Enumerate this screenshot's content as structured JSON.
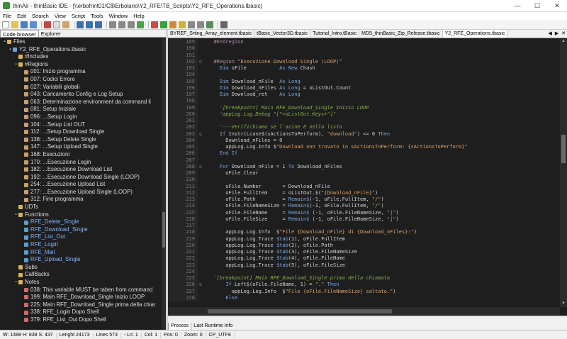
{
  "window": {
    "title": "thinAir - thinBasic IDE - [\\\\erbofrint01\\C$\\Erbolario\\Y2_RFE\\TB_Scripts\\Y2_RFE_Operations.tbasic]",
    "minimize": "—",
    "maximize": "☐",
    "close": "✕"
  },
  "menu": [
    "File",
    "Edit",
    "Search",
    "View",
    "Script",
    "Tools",
    "Window",
    "Help"
  ],
  "left_panel": {
    "tabs": [
      "Code browser",
      "Explorer"
    ],
    "tree": [
      {
        "indent": 0,
        "exp": "▪",
        "icon": "folder",
        "label": "Files"
      },
      {
        "indent": 1,
        "exp": "▪",
        "icon": "file",
        "label": "Y2_RFE_Operations.tbasic"
      },
      {
        "indent": 2,
        "exp": "",
        "icon": "folder",
        "label": "#Includes"
      },
      {
        "indent": 2,
        "exp": "▪",
        "icon": "folder",
        "label": "#Regions"
      },
      {
        "indent": 3,
        "exp": "",
        "icon": "region",
        "label": "001: Inizio programma"
      },
      {
        "indent": 3,
        "exp": "",
        "icon": "region",
        "label": "007: Codici Errore"
      },
      {
        "indent": 3,
        "exp": "",
        "icon": "region",
        "label": "027: Variabili globali"
      },
      {
        "indent": 3,
        "exp": "",
        "icon": "region",
        "label": "043: Caricamento Config e Log Setup"
      },
      {
        "indent": 3,
        "exp": "",
        "icon": "region",
        "label": "063: Determinazione environment da command li"
      },
      {
        "indent": 3,
        "exp": "",
        "icon": "region",
        "label": "081: Setup Iniziale"
      },
      {
        "indent": 3,
        "exp": "",
        "icon": "region",
        "label": "096: ...Setup Login"
      },
      {
        "indent": 3,
        "exp": "",
        "icon": "region",
        "label": "104: ...Setup List OUT"
      },
      {
        "indent": 3,
        "exp": "",
        "icon": "region",
        "label": "112: ...Setup Download Single"
      },
      {
        "indent": 3,
        "exp": "",
        "icon": "region",
        "label": "138: ...Setup Delete Single"
      },
      {
        "indent": 3,
        "exp": "",
        "icon": "region",
        "label": "147: ...Setup Upload Single"
      },
      {
        "indent": 3,
        "exp": "",
        "icon": "region",
        "label": "168: Esecuzioni"
      },
      {
        "indent": 3,
        "exp": "",
        "icon": "region",
        "label": "170: ...Esecuzione Login"
      },
      {
        "indent": 3,
        "exp": "",
        "icon": "region",
        "label": "182: ...Esecuzione Download List"
      },
      {
        "indent": 3,
        "exp": "",
        "icon": "region",
        "label": "192: ...Esecuzione Download Single (LOOP)"
      },
      {
        "indent": 3,
        "exp": "",
        "icon": "region",
        "label": "254: ...Esecuzione Upload List"
      },
      {
        "indent": 3,
        "exp": "",
        "icon": "region",
        "label": "277: ...Esecuzione Upload Single (LOOP)"
      },
      {
        "indent": 3,
        "exp": "",
        "icon": "region",
        "label": "312: Fine programma"
      },
      {
        "indent": 2,
        "exp": "",
        "icon": "folder",
        "label": "UDTs"
      },
      {
        "indent": 2,
        "exp": "▪",
        "icon": "folder",
        "label": "Functions"
      },
      {
        "indent": 3,
        "exp": "",
        "icon": "func",
        "label": "RFE_Delete_Single",
        "fn": true
      },
      {
        "indent": 3,
        "exp": "",
        "icon": "func",
        "label": "RFE_Download_Single",
        "fn": true
      },
      {
        "indent": 3,
        "exp": "",
        "icon": "func",
        "label": "RFE_List_Out",
        "fn": true
      },
      {
        "indent": 3,
        "exp": "",
        "icon": "func",
        "label": "RFE_Login",
        "fn": true
      },
      {
        "indent": 3,
        "exp": "",
        "icon": "func",
        "label": "RFE_Mail",
        "fn": true
      },
      {
        "indent": 3,
        "exp": "",
        "icon": "func",
        "label": "RFE_Upload_Single",
        "fn": true
      },
      {
        "indent": 2,
        "exp": "",
        "icon": "folder",
        "label": "Subs"
      },
      {
        "indent": 2,
        "exp": "",
        "icon": "folder",
        "label": "CallBacks"
      },
      {
        "indent": 2,
        "exp": "▪",
        "icon": "folder",
        "label": "Notes"
      },
      {
        "indent": 3,
        "exp": "",
        "icon": "note",
        "label": "038: This variable MUST be taben from command"
      },
      {
        "indent": 3,
        "exp": "",
        "icon": "note",
        "label": "199: Main RFE_Download_Single Inizio LOOP"
      },
      {
        "indent": 3,
        "exp": "",
        "icon": "note",
        "label": "225: Main RFE_Download_Single prima della chiar"
      },
      {
        "indent": 3,
        "exp": "",
        "icon": "note",
        "label": "338: RFE_Login Dopo Shell"
      },
      {
        "indent": 3,
        "exp": "",
        "icon": "note",
        "label": "379: RFE_List_Out Dopo Shell"
      }
    ]
  },
  "editor": {
    "tabs": [
      "BYREF_Srting_Array_element.tbasic",
      "tBasic_Vector3D.tbasic",
      "Tutorial_Intro.tBasic",
      "MD5_thinBasic_Zip_Release.tbasic",
      "Y2_RFE_Operations.tbasic"
    ],
    "active_tab": 4,
    "lines": [
      {
        "n": "189",
        "f": "",
        "h": "  <span class='meta'>#Endregion</span>"
      },
      {
        "n": "190",
        "f": "",
        "h": ""
      },
      {
        "n": "191",
        "f": "",
        "h": ""
      },
      {
        "n": "192",
        "f": "⊟",
        "h": "  <span class='meta'>#Region</span> <span class='str'>\"Esecuzione Download Single (LOOP)\"</span>"
      },
      {
        "n": "193",
        "f": "",
        "h": "    <span class='kw'>Dim</span> oFile           <span class='kw'>As New</span> Chash"
      },
      {
        "n": "194",
        "f": "",
        "h": ""
      },
      {
        "n": "195",
        "f": "",
        "h": "    <span class='kw'>Dim</span> Download_nFile  <span class='kw'>As Long</span>"
      },
      {
        "n": "196",
        "f": "",
        "h": "    <span class='kw'>Dim</span> Download_nFiles <span class='kw'>As Long</span> = oListOut.Count"
      },
      {
        "n": "197",
        "f": "",
        "h": "    <span class='kw'>Dim</span> Download_ret    <span class='kw'>As Long</span>"
      },
      {
        "n": "198",
        "f": "",
        "h": ""
      },
      {
        "n": "199",
        "f": "",
        "h": "    <span class='com'>'[breakpoint] Main RFE_Download_Single Inizio LOOP</span>"
      },
      {
        "n": "200",
        "f": "",
        "h": "    <span class='com'>'appLog.Log.Debug \"[\"+oListOut.Keys+\"]\"</span>"
      },
      {
        "n": "201",
        "f": "",
        "h": ""
      },
      {
        "n": "202",
        "f": "",
        "h": "    <span class='com'>'---Verifichiamo se l'azine è nella lista</span>"
      },
      {
        "n": "203",
        "f": "⊟",
        "h": "    <span class='kw'>If</span> Instr(Lcase$(sActionsToPerform), <span class='str'>\"download\"</span>) &lt;= 0 <span class='kw'>Then</span>"
      },
      {
        "n": "204",
        "f": "",
        "h": "      Download_nFiles = 0"
      },
      {
        "n": "205",
        "f": "",
        "h": "      appLog.Log.Info $<span class='str'>\"Download non trovato in sActionsToPerform: {sActionsToPerform}\"</span>"
      },
      {
        "n": "206",
        "f": "",
        "h": "    <span class='kw'>End If</span>"
      },
      {
        "n": "207",
        "f": "",
        "h": ""
      },
      {
        "n": "208",
        "f": "⊟",
        "h": "    <span class='kw'>For</span> Download_nFile = 1 <span class='kw'>To</span> Download_nFiles"
      },
      {
        "n": "209",
        "f": "",
        "h": "      oFile.Clear"
      },
      {
        "n": "210",
        "f": "",
        "h": ""
      },
      {
        "n": "211",
        "f": "",
        "h": "      oFile.Number       = Download_nFile"
      },
      {
        "n": "212",
        "f": "",
        "h": "      oFile.FullItem     = oListOut.$(<span class='str'>\"{Download_nFile}\"</span>)"
      },
      {
        "n": "213",
        "f": "",
        "h": "      oFile.Path         = <span class='kw'>Remain$</span>(-1, oFile.FullItem, <span class='str'>\"/\"</span>)"
      },
      {
        "n": "214",
        "f": "",
        "h": "      oFile.FileNameSize = <span class='kw'>Remain$</span>(-1, oFile.FullItem, <span class='str'>\"/\"</span>)"
      },
      {
        "n": "215",
        "f": "",
        "h": "      oFile.FileName     = <span class='kw'>Remain$</span> (-1, oFile.FileNameSize, <span class='str'>\"|\"</span>)"
      },
      {
        "n": "216",
        "f": "",
        "h": "      oFile.FileSize     = <span class='kw'>Remain$</span> (-1, oFile.FileNameSize, <span class='str'>\"|\"</span>)"
      },
      {
        "n": "217",
        "f": "",
        "h": ""
      },
      {
        "n": "218",
        "f": "",
        "h": "      appLog.Log.Info  $<span class='str'>\"File {Download_nFile} di {Download_nFiles}:\"</span>)"
      },
      {
        "n": "219",
        "f": "",
        "h": "      appLog.Log.Trace <span class='kw'>$tab</span>(1), oFile.FullItem"
      },
      {
        "n": "220",
        "f": "",
        "h": "      appLog.Log.Trace <span class='kw'>$tab</span>(2), oFile.Path"
      },
      {
        "n": "221",
        "f": "",
        "h": "      appLog.Log.Trace <span class='kw'>$tab</span>(3), oFile.FileNameSize"
      },
      {
        "n": "222",
        "f": "",
        "h": "      appLog.Log.Trace <span class='kw'>$tab</span>(4), oFile.FileName"
      },
      {
        "n": "223",
        "f": "",
        "h": "      appLog.Log.Trace <span class='kw'>$tab</span>(5), oFile.FileSize"
      },
      {
        "n": "224",
        "f": "",
        "h": ""
      },
      {
        "n": "225",
        "f": "",
        "h": "  <span class='com'>'[breakpoint] Main RFE_Download_Single prima della chiamata</span>"
      },
      {
        "n": "226",
        "f": "⊟",
        "h": "      <span class='kw'>If</span> Left$(oFile.FileName, 1) = <span class='str'>\".\"</span> <span class='kw'>Then</span>"
      },
      {
        "n": "227",
        "f": "",
        "h": "        appLog.Log.Info  $<span class='str'>\"File {oFile.FileNameSize} saltato.\"</span>)"
      },
      {
        "n": "228",
        "f": "",
        "h": "      <span class='kw'>Else</span>"
      }
    ]
  },
  "bottom_tabs": [
    "Process",
    "Last Runtime Info"
  ],
  "status": {
    "size": "W: 1488 H: 838 S: 437",
    "length": "Lenght 24173",
    "lines": "Lines 573",
    "ln": "- Ln: 1",
    "col": "Col: 1",
    "pos": "Pos: 0",
    "zoom": "Zoom: 0",
    "enc": "CP_UTF8"
  },
  "colors": {
    "editor_bg": "#1e1e1e",
    "keyword": "#7aa6e0",
    "string": "#d8a26a",
    "comment": "#8ab04a"
  }
}
